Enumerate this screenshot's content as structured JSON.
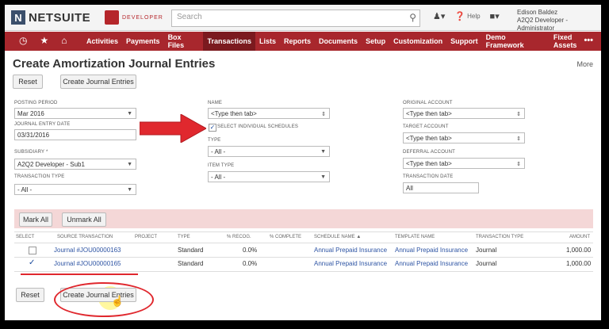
{
  "header": {
    "logo_text": "NETSUITE",
    "logo_letter": "N",
    "developer_badge": "DEVELOPER",
    "search_placeholder": "Search",
    "help_label": "Help",
    "user_name": "Edison Baldez",
    "user_role": "A2Q2 Developer - Administrator"
  },
  "nav": {
    "items": [
      "Activities",
      "Payments",
      "Box Files",
      "Transactions",
      "Lists",
      "Reports",
      "Documents",
      "Setup",
      "Customization",
      "Support",
      "Demo Framework",
      "Fixed Assets"
    ],
    "active": "Transactions",
    "more": "•••"
  },
  "page": {
    "title": "Create Amortization Journal Entries",
    "more_link": "More",
    "reset_label": "Reset",
    "create_label": "Create Journal Entries"
  },
  "form": {
    "posting_period_label": "POSTING PERIOD",
    "posting_period_value": "Mar 2016",
    "journal_entry_date_label": "JOURNAL ENTRY DATE",
    "journal_entry_date_value": "03/31/2016",
    "subsidiary_label": "SUBSIDIARY *",
    "subsidiary_value": "A2Q2 Developer - Sub1",
    "transaction_type_label": "TRANSACTION TYPE",
    "transaction_type_value": "- All -",
    "name_label": "NAME",
    "name_placeholder": "<Type then tab>",
    "select_individual_label": "SELECT INDIVIDUAL SCHEDULES",
    "type_label": "TYPE",
    "type_value": "- All -",
    "item_type_label": "ITEM TYPE",
    "item_type_value": "- All -",
    "original_account_label": "ORIGINAL ACCOUNT",
    "original_account_value": "<Type then tab>",
    "target_account_label": "TARGET ACCOUNT",
    "target_account_value": "<Type then tab>",
    "deferral_account_label": "DEFERRAL ACCOUNT",
    "deferral_account_value": "<Type then tab>",
    "transaction_date_label": "TRANSACTION DATE",
    "transaction_date_value": "All"
  },
  "sublist": {
    "mark_all": "Mark All",
    "unmark_all": "Unmark All",
    "headers": [
      "SELECT",
      "SOURCE TRANSACTION",
      "PROJECT",
      "TYPE",
      "% RECOG.",
      "% COMPLETE",
      "SCHEDULE NAME ▲",
      "TEMPLATE NAME",
      "TRANSACTION TYPE",
      "AMOUNT"
    ],
    "rows": [
      {
        "checked": false,
        "source": "Journal #JOU00000163",
        "type": "Standard",
        "recog": "0.0%",
        "schedule": "Annual Prepaid Insurance",
        "template": "Annual Prepaid Insurance",
        "txn_type": "Journal",
        "amount": "1,000.00"
      },
      {
        "checked": true,
        "source": "Journal #JOU00000165",
        "type": "Standard",
        "recog": "0.0%",
        "schedule": "Annual Prepaid Insurance",
        "template": "Annual Prepaid Insurance",
        "txn_type": "Journal",
        "amount": "1,000.00"
      }
    ]
  },
  "colors": {
    "nav_bg": "#a8272d",
    "annotation_red": "#e0282e",
    "link_blue": "#2f55a4"
  }
}
